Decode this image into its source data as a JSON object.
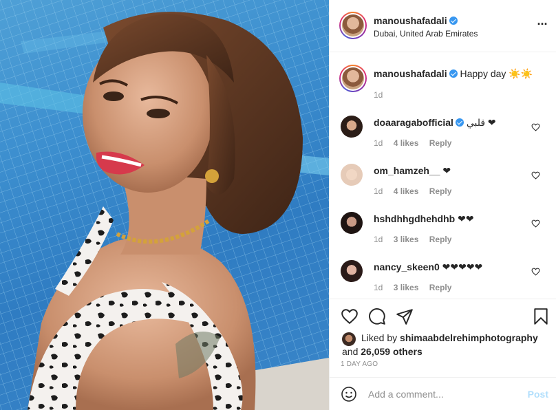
{
  "post": {
    "author": "manoushafadali",
    "location": "Dubai, United Arab Emirates",
    "caption_text": "Happy day ☀️☀️",
    "caption_time": "1d"
  },
  "comments": [
    {
      "user": "doaaragabofficial",
      "verified": true,
      "text": "قلبي ❤",
      "time": "1d",
      "likes": "4 likes",
      "reply": "Reply"
    },
    {
      "user": "om_hamzeh__",
      "verified": false,
      "text": "❤",
      "time": "1d",
      "likes": "4 likes",
      "reply": "Reply"
    },
    {
      "user": "hshdhhgdhehdhb",
      "verified": false,
      "text": "❤❤",
      "time": "1d",
      "likes": "3 likes",
      "reply": "Reply"
    },
    {
      "user": "nancy_skeen0",
      "verified": false,
      "text": "❤❤❤❤❤",
      "time": "1d",
      "likes": "3 likes",
      "reply": "Reply"
    }
  ],
  "likes": {
    "liked_by_prefix": "Liked by",
    "liked_by_user": "shimaabdelrehimphotography",
    "and_text": "and",
    "others": "26,059 others",
    "age": "1 DAY AGO"
  },
  "add_comment": {
    "placeholder": "Add a comment...",
    "post_label": "Post"
  },
  "icons": {
    "more": "more-horizontal-icon",
    "heart": "heart-icon",
    "comment": "comment-bubble-icon",
    "share": "paper-plane-icon",
    "save": "bookmark-icon",
    "emoji": "smiley-icon"
  },
  "colors": {
    "verified": "#3897f0",
    "muted_text": "#8e8e8e",
    "post_button_disabled": "#b2dffc"
  }
}
